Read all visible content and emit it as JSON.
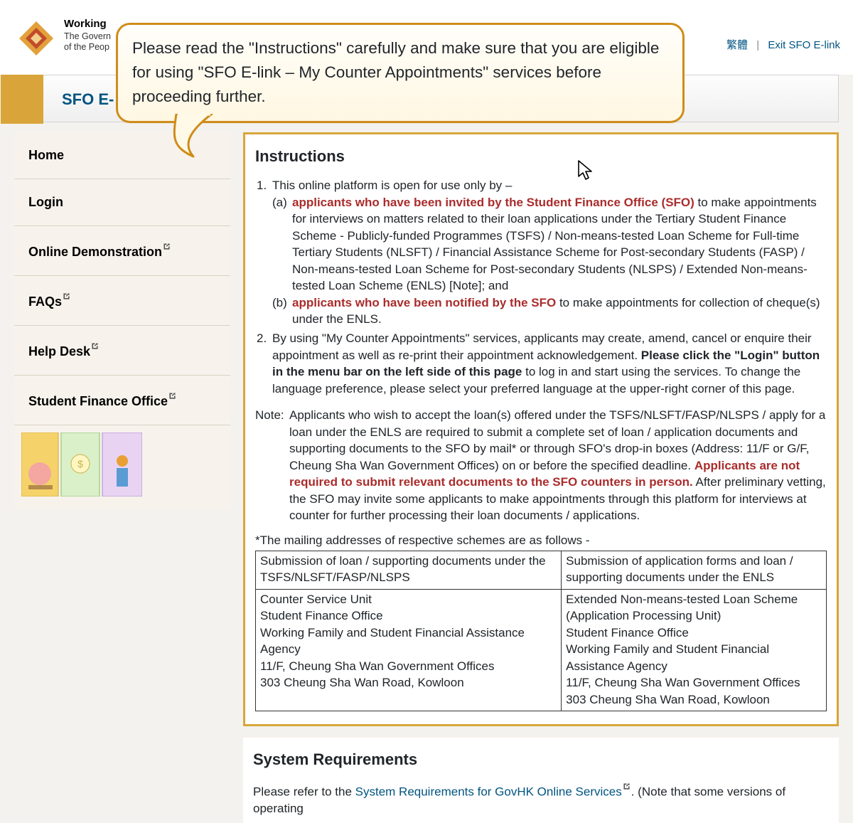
{
  "header": {
    "org_line1": "Working",
    "org_line2": "The Govern",
    "org_line3": "of the Peop",
    "lang_link": "繁體",
    "exit_link": "Exit SFO E-link"
  },
  "titlebar": {
    "text": "SFO E-"
  },
  "sidebar": {
    "items": [
      {
        "label": "Home",
        "ext": false
      },
      {
        "label": "Login",
        "ext": false
      },
      {
        "label": "Online Demonstration",
        "ext": true
      },
      {
        "label": "FAQs",
        "ext": true
      },
      {
        "label": "Help Desk",
        "ext": true
      },
      {
        "label": "Student Finance Office",
        "ext": true
      }
    ]
  },
  "callout": {
    "text": "Please read the \"Instructions\" carefully and make sure that you are eligible for using \"SFO E-link – My Counter Appointments\" services before proceeding further."
  },
  "instructions": {
    "heading": "Instructions",
    "item1_intro": "This online platform is open for use only by –",
    "a_marker": "(a)",
    "a_hl": "applicants who have been invited by the Student Finance Office (SFO)",
    "a_rest": " to make appointments for interviews on matters related to their loan applications under the Tertiary Student Finance Scheme - Publicly-funded Programmes (TSFS) / Non-means-tested Loan Scheme for Full-time Tertiary Students (NLSFT) / Financial Assistance Scheme for Post-secondary Students (FASP) / Non-means-tested Loan Scheme for Post-secondary Students (NLSPS) / Extended Non-means-tested Loan Scheme (ENLS) [Note]; and",
    "b_marker": "(b)",
    "b_hl": "applicants who have been notified by the SFO",
    "b_rest": " to make appointments for collection of cheque(s) under the ENLS.",
    "item2_lead": "By using \"My Counter Appointments\" services, applicants may create, amend, cancel or enquire their appointment as well as re-print their appointment acknowledgement. ",
    "item2_bold": "Please click the \"Login\" button in the menu bar on the left side of this page",
    "item2_rest": " to log in and start using the services. To change the language preference, please select your preferred language at the upper-right corner of this page.",
    "note_label": "Note:",
    "note_body_lead": "Applicants who wish to accept the loan(s) offered under the TSFS/NLSFT/FASP/NLSPS / apply for a loan under the ENLS are required to submit a complete set of loan / application documents and supporting documents to the SFO by mail* or through SFO's drop-in boxes (Address: 11/F or G/F, Cheung Sha Wan Government Offices) on or before the specified deadline. ",
    "note_body_hl": "Applicants are not required to submit relevant documents to the SFO counters in person.",
    "note_body_rest": " After preliminary vetting, the SFO may invite some applicants to make appointments through this platform for interviews at counter for further processing their loan documents / applications.",
    "mailing_caption": "*The mailing addresses of respective schemes are as follows -",
    "addr_table": {
      "h1": "Submission of loan / supporting documents under the TSFS/NLSFT/FASP/NLSPS",
      "h2": "Submission of application forms and loan / supporting documents under the ENLS",
      "c1": "Counter Service Unit\nStudent Finance Office\nWorking Family and Student Financial Assistance Agency\n11/F, Cheung Sha Wan Government Offices\n303 Cheung Sha Wan Road, Kowloon",
      "c2": "Extended Non-means-tested Loan Scheme (Application Processing Unit)\nStudent Finance Office\nWorking Family and Student Financial Assistance Agency\n11/F, Cheung Sha Wan Government Offices\n303 Cheung Sha Wan Road, Kowloon"
    }
  },
  "sysreq": {
    "heading": "System Requirements",
    "text_lead": "Please refer to the ",
    "link": "System Requirements for GovHK Online Services",
    "text_trail": ". (Note that some versions of operating"
  }
}
